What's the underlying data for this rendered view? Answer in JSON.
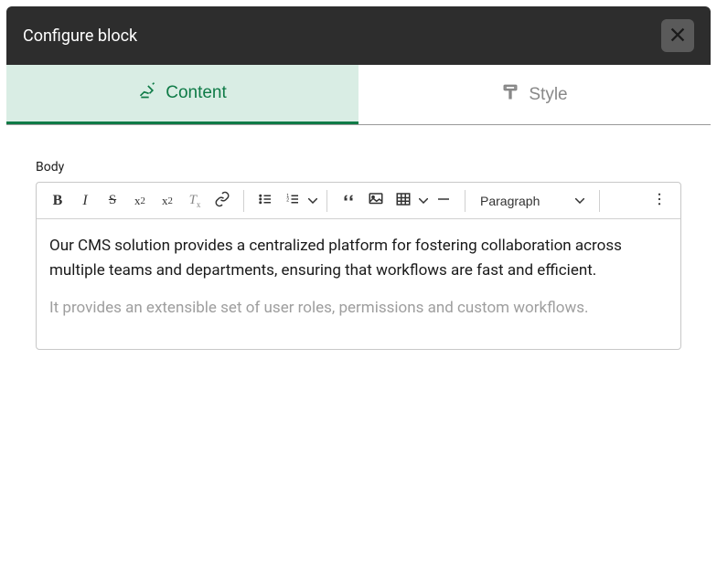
{
  "modal": {
    "title": "Configure block"
  },
  "tabs": {
    "content": "Content",
    "style": "Style"
  },
  "field": {
    "body_label": "Body"
  },
  "toolbar": {
    "format_select": "Paragraph"
  },
  "editor": {
    "para1": "Our CMS solution provides a centralized platform for fostering collaboration across multiple teams and departments, ensuring that workflows are fast and efficient.",
    "para2": "It provides an extensible set of user roles, permissions and custom workflows."
  }
}
